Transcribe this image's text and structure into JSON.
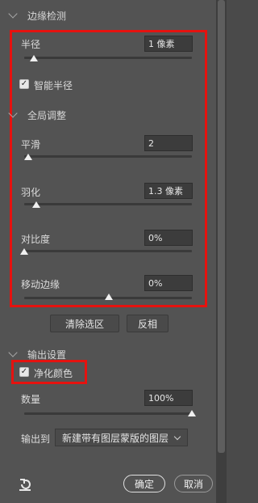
{
  "edge_detection": {
    "title": "边缘检测",
    "radius": {
      "label": "半径",
      "value": "1 像素",
      "level": 0.06
    },
    "smart_radius": {
      "label": "智能半径",
      "checked": true
    }
  },
  "global_refine": {
    "title": "全局调整",
    "smooth": {
      "label": "平滑",
      "value": "2",
      "level": 0.02
    },
    "feather": {
      "label": "羽化",
      "value": "1.3 像素",
      "level": 0.07
    },
    "contrast": {
      "label": "对比度",
      "value": "0%",
      "level": 0.0
    },
    "shift_edge": {
      "label": "移动边缘",
      "value": "0%",
      "level": 0.5
    }
  },
  "actions": {
    "clear_selection": "清除选区",
    "invert": "反相"
  },
  "output": {
    "title": "输出设置",
    "decontaminate": {
      "label": "净化颜色",
      "checked": true
    },
    "amount": {
      "label": "数量",
      "value": "100%",
      "level": 1.0
    },
    "output_to_label": "输出到",
    "output_to_value": "新建带有图层蒙版的图层"
  },
  "footer": {
    "ok": "确定",
    "cancel": "取消",
    "reset_icon": "reset-icon"
  },
  "colors": {
    "highlight": "#e5120f",
    "panel": "#535353"
  }
}
